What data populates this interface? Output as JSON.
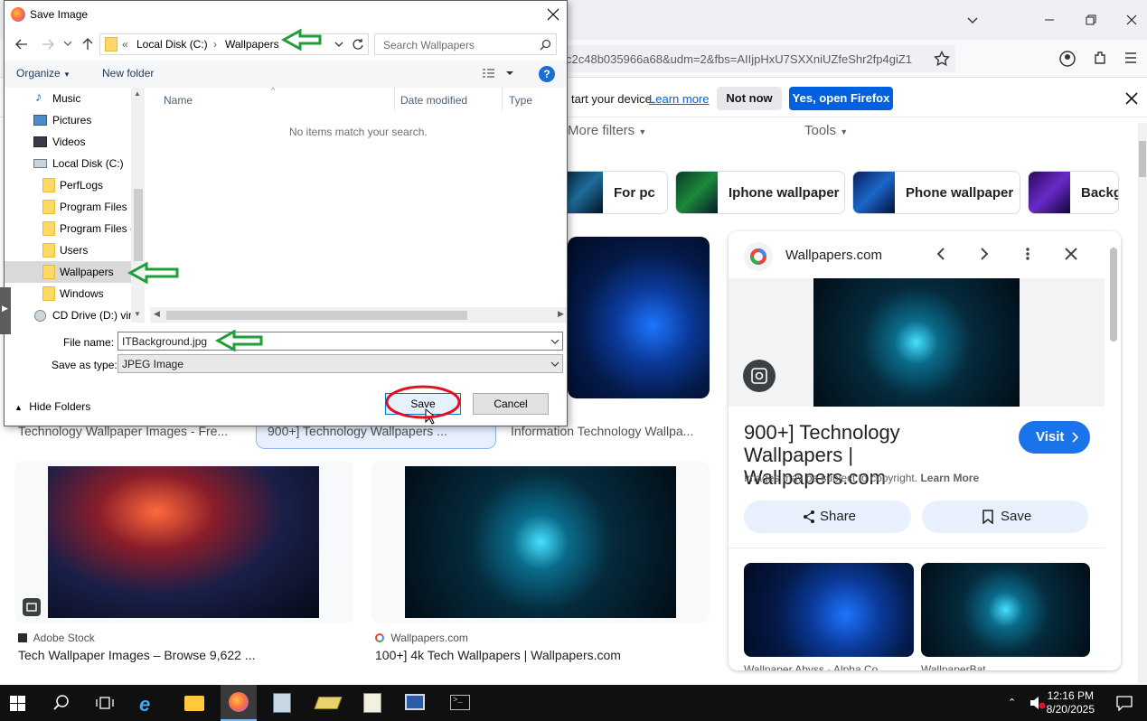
{
  "browser": {
    "url": "c2c48b035966a68&udm=2&fbs=AIIjpHxU7SXXniUZfeShr2fp4giZ1",
    "notification": {
      "text": "tart your device.",
      "learn_more": "Learn more",
      "not_now": "Not now",
      "open_firefox": "Yes, open Firefox"
    }
  },
  "page": {
    "filters": {
      "more_filters": "More filters",
      "tools": "Tools"
    },
    "chips": [
      "For pc",
      "Iphone wallpaper",
      "Phone wallpaper",
      "Backgr"
    ],
    "results_top": {
      "left": "Technology Wallpaper Images - Fre...",
      "middle": "900+] Technology Wallpapers ...",
      "right": "Information Technology Wallpa..."
    },
    "results": [
      {
        "source": "Adobe Stock",
        "title": "Tech Wallpaper Images – Browse 9,622 ..."
      },
      {
        "source": "Wallpapers.com",
        "title": "100+] 4k Tech Wallpapers | Wallpapers.com"
      }
    ]
  },
  "panel": {
    "site": "Wallpapers.com",
    "title": "900+] Technology Wallpapers | Wallpapers.com",
    "visit": "Visit",
    "copyright": "Images may be subject to copyright.",
    "learn_more": "Learn More",
    "share": "Share",
    "save": "Save",
    "related_captions": [
      "Wallpaper Abyss - Alpha Co...",
      "WallpaperBat"
    ]
  },
  "dialog": {
    "title": "Save Image",
    "breadcrumb": {
      "prefix": "«",
      "drive": "Local Disk (C:)",
      "folder": "Wallpapers"
    },
    "search_placeholder": "Search Wallpapers",
    "organize": "Organize",
    "new_folder": "New folder",
    "tree": [
      "Music",
      "Pictures",
      "Videos",
      "Local Disk (C:)",
      "PerfLogs",
      "Program Files",
      "Program Files (",
      "Users",
      "Wallpapers",
      "Windows",
      "CD Drive (D:) vir"
    ],
    "tree_selected": "Wallpapers",
    "columns": [
      "Name",
      "Date modified",
      "Type"
    ],
    "empty_message": "No items match your search.",
    "file_name_label": "File name:",
    "file_name_value": "ITBackground.jpg",
    "save_as_label": "Save as type:",
    "save_as_value": "JPEG Image",
    "hide_folders": "Hide Folders",
    "save": "Save",
    "cancel": "Cancel"
  },
  "taskbar": {
    "time": "12:16 PM",
    "date": "8/20/2025"
  },
  "colors": {
    "accent_blue": "#1a73e8",
    "firefox_blue": "#0061e0",
    "annotation_green": "#1f9e3a",
    "annotation_red": "#e0101e"
  }
}
